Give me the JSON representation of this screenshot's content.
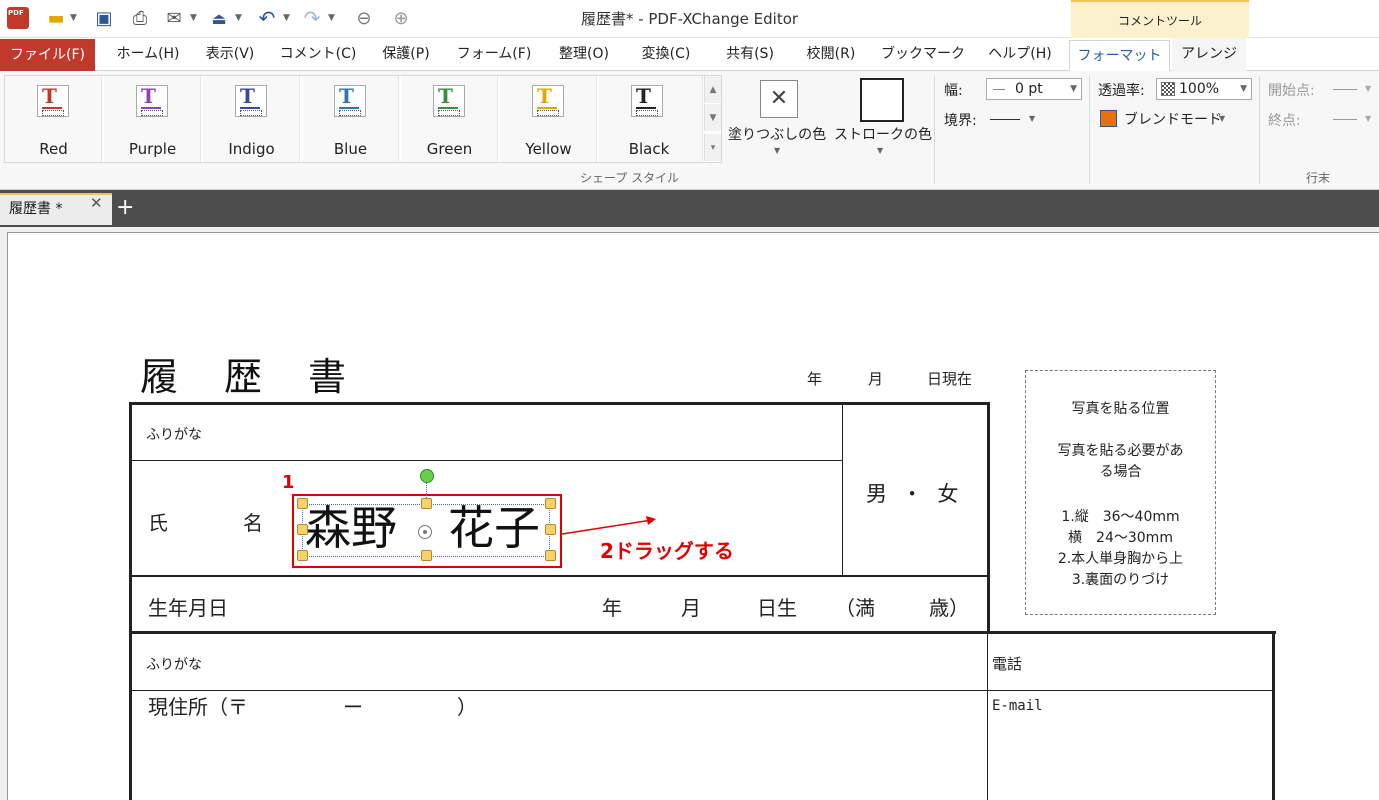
{
  "window": {
    "title": "履歴書* - PDF-XChange Editor",
    "context_group": "コメントツール"
  },
  "menu_tabs": [
    {
      "label": "ファイル(F)"
    },
    {
      "label": "ホーム(H)"
    },
    {
      "label": "表示(V)"
    },
    {
      "label": "コメント(C)"
    },
    {
      "label": "保護(P)"
    },
    {
      "label": "フォーム(F)"
    },
    {
      "label": "整理(O)"
    },
    {
      "label": "変換(C)"
    },
    {
      "label": "共有(S)"
    },
    {
      "label": "校閲(R)"
    },
    {
      "label": "ブックマーク"
    },
    {
      "label": "ヘルプ(H)"
    },
    {
      "label": "フォーマット"
    },
    {
      "label": "アレンジ"
    }
  ],
  "shape_styles": [
    {
      "label": "Red",
      "color": "#c0392b"
    },
    {
      "label": "Purple",
      "color": "#8e44ad"
    },
    {
      "label": "Indigo",
      "color": "#3b4a8c"
    },
    {
      "label": "Blue",
      "color": "#2e75b6"
    },
    {
      "label": "Green",
      "color": "#3b8d3b"
    },
    {
      "label": "Yellow",
      "color": "#e0a800"
    },
    {
      "label": "Black",
      "color": "#222222"
    }
  ],
  "ribbon": {
    "group_label": "シェープ スタイル",
    "fill_label": "塗りつぶしの色",
    "stroke_label": "ストロークの色",
    "width_label": "幅:",
    "width_value": "0 pt",
    "border_label": "境界:",
    "opacity_label": "透過率:",
    "opacity_value": "100%",
    "blend_label": "ブレンドモード",
    "start_label": "開始点:",
    "end_label": "終点:",
    "lineend_label": "行末"
  },
  "doc_tab": {
    "label": "履歴書 *"
  },
  "resume": {
    "title": "履　歴　書",
    "date_year": "年",
    "date_month": "月",
    "date_day": "日現在",
    "furigana1": "ふりがな",
    "name_label1": "氏",
    "name_label2": "名",
    "name_value1": "森野",
    "name_value2": "花子",
    "gender": "男 ・ 女",
    "birth_label": "生年月日",
    "birth_year": "年",
    "birth_month": "月",
    "birth_day": "日生",
    "birth_age_open": "（満",
    "birth_age_close": "歳）",
    "furigana2": "ふりがな",
    "phone": "電話",
    "address_label": "現住所（〒",
    "address_dash": "ー",
    "address_close": "）",
    "email": "E-mail"
  },
  "photo_box": {
    "title": "写真を貼る位置",
    "line1": "写真を貼る必要があ",
    "line2": "る場合",
    "item1": "1.縦　36〜40mm",
    "item2": "横　24〜30mm",
    "item3": "2.本人単身胸から上",
    "item4": "3.裏面のりづけ"
  },
  "annotations": {
    "step1": "1",
    "step2": "2ドラッグする",
    "color": "#e00000"
  }
}
